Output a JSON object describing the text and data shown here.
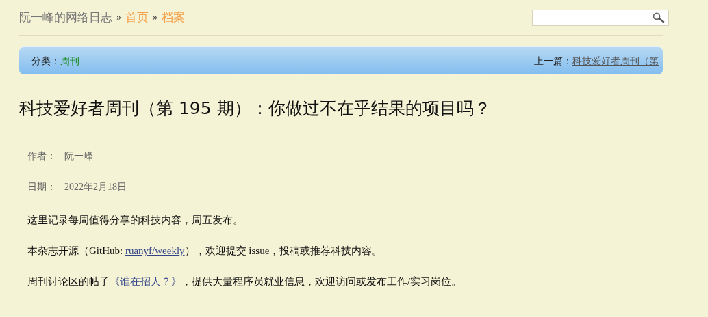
{
  "breadcrumb": [
    {
      "kind": "text",
      "label": "阮一峰的网络日志"
    },
    {
      "kind": "sep",
      "label": "»"
    },
    {
      "kind": "link",
      "label": "首页"
    },
    {
      "kind": "sep",
      "label": "»"
    },
    {
      "kind": "link",
      "label": "档案"
    }
  ],
  "category_bar": {
    "label": "分类：",
    "category": "周刊",
    "prev_label": "上一篇：",
    "prev_title": "科技爱好者周刊（第"
  },
  "title": "科技爱好者周刊（第 195 期）：你做过不在乎结果的项目吗？",
  "meta": [
    {
      "label": "作者：",
      "value": "阮一峰"
    },
    {
      "label": "日期：",
      "value": "2022年2月18日"
    }
  ],
  "paragraphs": [
    {
      "before": "这里记录每周值得分享的科技内容，周五发布。"
    },
    {
      "before": "本杂志开源（GitHub: ",
      "link": "ruanyf/weekly",
      "after": "），欢迎提交 issue，投稿或推荐科技内容。"
    },
    {
      "before": "周刊讨论区的帖子",
      "link": "《谁在招人？》",
      "after": "，提供大量程序员就业信息，欢迎访问或发布工作/实习岗位。"
    }
  ]
}
